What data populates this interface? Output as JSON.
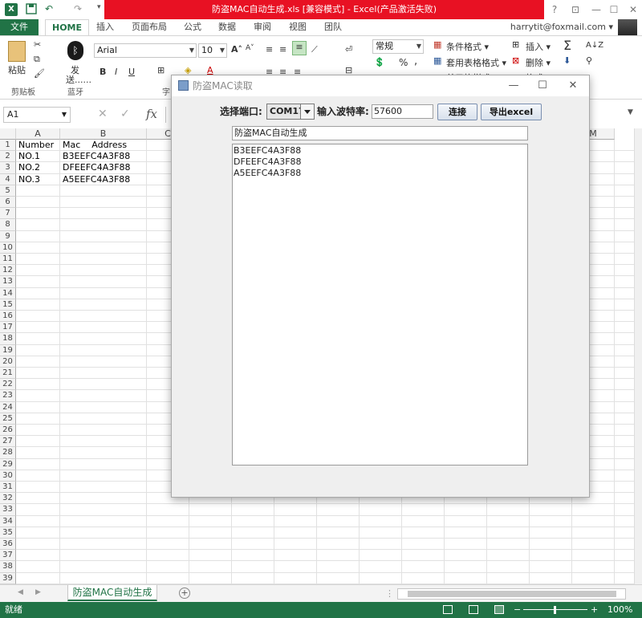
{
  "window": {
    "title": "防盗MAC自动生成.xls  [兼容模式] -  Excel(产品激活失败)",
    "help_glyph": "?",
    "restore_glyph": "⊡",
    "min_glyph": "—",
    "max_glyph": "☐",
    "close_glyph": "✕"
  },
  "quick_access": {
    "save_icon": "save-icon",
    "undo_icon": "undo-icon",
    "redo_icon": "redo-icon",
    "undo": "↶",
    "redo": "↷",
    "more": "▾"
  },
  "ribbon": {
    "file_tab": "文件",
    "tabs": [
      "HOME",
      "插入",
      "页面布局",
      "公式",
      "数据",
      "审阅",
      "视图",
      "团队"
    ],
    "account": "harrytit@foxmail.com",
    "account_arrow": "▾",
    "paste_label": "粘贴",
    "clipboard_group": "剪贴板",
    "bluetooth_label": "发",
    "bluetooth_label2": "送......",
    "bluetooth_group": "蓝牙",
    "font_group_fragment": "字",
    "font_name": "Arial",
    "font_size": "10",
    "bold": "B",
    "italic": "I",
    "underline": "U",
    "number_format": "常规",
    "percent": "%",
    "comma": ",",
    "conditional_format": "条件格式",
    "table_format": "套用表格格式",
    "cell_styles_fragment": "单元格样式",
    "insert": "插入",
    "delete": "删除",
    "format_fragment": "格式",
    "sum": "Σ",
    "sort": "A↓Z",
    "find_icon": "binoculars-icon"
  },
  "formula_bar": {
    "name_box": "A1",
    "cancel": "✕",
    "enter": "✓",
    "fx": "fx"
  },
  "grid": {
    "columns": [
      "A",
      "B",
      "C",
      "D",
      "E",
      "F",
      "G",
      "H",
      "I",
      "J",
      "K",
      "L",
      "M"
    ],
    "rows": [
      "1",
      "2",
      "3",
      "4",
      "5",
      "6",
      "7",
      "8",
      "9",
      "10",
      "11",
      "12",
      "13",
      "14",
      "15",
      "16",
      "17",
      "18",
      "19",
      "20",
      "21",
      "22",
      "23",
      "24",
      "25",
      "26",
      "27",
      "28",
      "29",
      "30",
      "31",
      "32",
      "33",
      "34",
      "35",
      "36",
      "37",
      "38",
      "39"
    ],
    "cells": [
      [
        "Number",
        "Mac    Address"
      ],
      [
        "NO.1",
        "B3EEFC4A3F88"
      ],
      [
        "NO.2",
        "DFEEFC4A3F88"
      ],
      [
        "NO.3",
        "A5EEFC4A3F88"
      ]
    ]
  },
  "sheet_tabs": {
    "active": "防盗MAC自动生成",
    "add": "+"
  },
  "status": {
    "ready": "就绪",
    "zoom": "100%",
    "zoom_minus": "−",
    "zoom_plus": "+"
  },
  "dialog": {
    "title": "防盗MAC读取",
    "min_glyph": "—",
    "max_glyph": "☐",
    "close_glyph": "✕",
    "port_label": "选择端口:",
    "port_value": "COM17",
    "baud_label": "输入波特率:",
    "baud_value": "57600",
    "connect_button": "连接",
    "export_button": "导出excel",
    "sheet_name_value": "防盗MAC自动生成",
    "mac_list": [
      "B3EEFC4A3F88",
      "DFEEFC4A3F88",
      "A5EEFC4A3F88"
    ]
  }
}
